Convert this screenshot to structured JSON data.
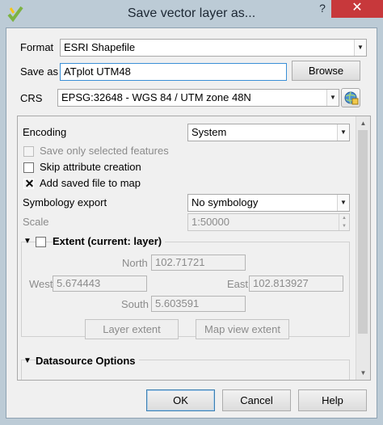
{
  "window": {
    "title": "Save vector layer as...",
    "help_glyph": "?",
    "close_glyph": "✕"
  },
  "format": {
    "label": "Format",
    "value": "ESRI Shapefile"
  },
  "save_as": {
    "label": "Save as",
    "value": "ATplot UTM48",
    "browse_label": "Browse"
  },
  "crs": {
    "label": "CRS",
    "value": "EPSG:32648 - WGS 84 / UTM zone 48N"
  },
  "encoding": {
    "label": "Encoding",
    "value": "System"
  },
  "options": {
    "save_selected": {
      "label": "Save only selected features",
      "checked": false,
      "enabled": false
    },
    "skip_attr": {
      "label": "Skip attribute creation",
      "checked": false,
      "enabled": true
    },
    "add_to_map": {
      "label": "Add saved file to map",
      "checked": true,
      "enabled": true,
      "mark": "✕"
    }
  },
  "symbology": {
    "label": "Symbology export",
    "value": "No symbology"
  },
  "scale": {
    "label": "Scale",
    "value": "1:50000"
  },
  "extent": {
    "title": "Extent (current: layer)",
    "north_label": "North",
    "north": "102.71721",
    "west_label": "West",
    "west": "5.674443",
    "east_label": "East",
    "east": "102.813927",
    "south_label": "South",
    "south": "5.603591",
    "layer_extent_label": "Layer extent",
    "map_view_extent_label": "Map view extent"
  },
  "datasource": {
    "title": "Datasource Options"
  },
  "glyphs": {
    "down": "▼",
    "up": "▲",
    "collapse": "▼"
  },
  "buttons": {
    "ok": "OK",
    "cancel": "Cancel",
    "help": "Help"
  },
  "colors": {
    "close": "#c7383b",
    "titlebar": "#bccbd6",
    "focus": "#3a8fd6"
  }
}
